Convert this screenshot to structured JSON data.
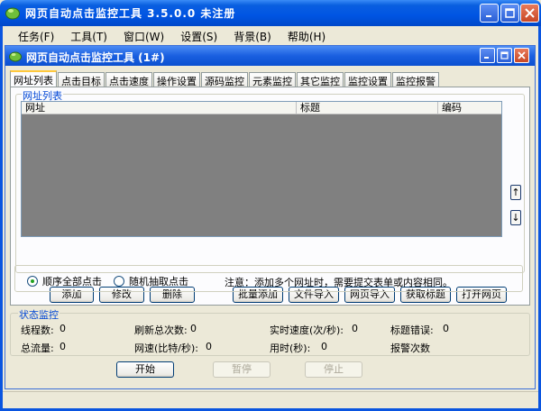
{
  "outer_window": {
    "title": "网页自动点击监控工具 3.5.0.0  未注册"
  },
  "menu": [
    {
      "label": "任务(F)"
    },
    {
      "label": "工具(T)"
    },
    {
      "label": "窗口(W)"
    },
    {
      "label": "设置(S)"
    },
    {
      "label": "背景(B)"
    },
    {
      "label": "帮助(H)"
    }
  ],
  "inner_window": {
    "title": "网页自动点击监控工具    (1#)"
  },
  "tabs": [
    {
      "label": "网址列表",
      "active": true
    },
    {
      "label": "点击目标"
    },
    {
      "label": "点击速度"
    },
    {
      "label": "操作设置"
    },
    {
      "label": "源码监控"
    },
    {
      "label": "元素监控"
    },
    {
      "label": "其它监控"
    },
    {
      "label": "监控设置"
    },
    {
      "label": "监控报警"
    }
  ],
  "url_list": {
    "group_title": "网址列表",
    "columns": [
      "网址",
      "标题",
      "编码"
    ],
    "move_up": "↑",
    "move_down": "↓"
  },
  "buttons": {
    "add": "添加",
    "edit": "修改",
    "delete": "删除",
    "batch_add": "批量添加",
    "file_import": "文件导入",
    "web_import": "网页导入",
    "get_title": "获取标题",
    "open_page": "打开网页"
  },
  "click_mode": {
    "sequential": "顺序全部点击",
    "random": "随机抽取点击",
    "selected": "sequential",
    "note": "注意：添加多个网址时，需要提交表单或内容相同。"
  },
  "status": {
    "title": "状态监控",
    "threads_label": "线程数:",
    "threads_value": "0",
    "refresh_label": "刷新总次数:",
    "refresh_value": "0",
    "speed_label": "实时速度(次/秒):",
    "speed_value": "0",
    "title_err_label": "标题错误:",
    "title_err_value": "0",
    "traffic_label": "总流量:",
    "traffic_value": "0",
    "netspeed_label": "网速(比特/秒):",
    "netspeed_value": "0",
    "time_label": "用时(秒):",
    "time_value": "0",
    "alarm_label": "报警次数"
  },
  "controls": {
    "start": "开始",
    "pause": "暂停",
    "stop": "停止"
  },
  "colors": {
    "titlebar": "#0054e3",
    "legend_blue": "#0046d5",
    "table_bg": "#808080"
  }
}
